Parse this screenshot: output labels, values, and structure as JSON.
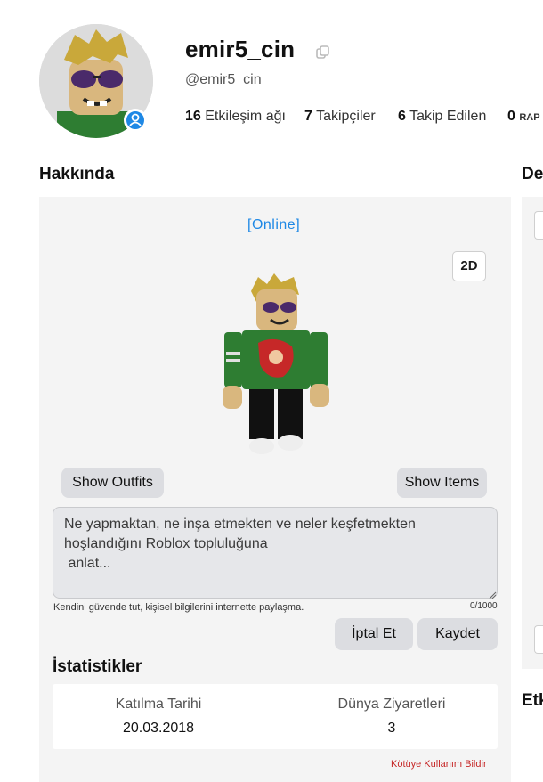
{
  "profile": {
    "display_name": "emir5_cin",
    "handle": "@emir5_cin",
    "stats": [
      {
        "count": "16",
        "label": "Etkileşim ağı"
      },
      {
        "count": "7",
        "label": "Takipçiler"
      },
      {
        "count": "6",
        "label": "Takip Edilen"
      },
      {
        "count": "0",
        "label": "RAP"
      }
    ]
  },
  "about": {
    "title": "Hakkında",
    "online_status": "[Online]",
    "view_toggle_label": "2D",
    "show_outfits_label": "Show Outfits",
    "show_items_label": "Show Items",
    "bio_placeholder": "Ne yapmaktan, ne inşa etmekten ve neler keşfetmekten hoşlandığını Roblox topluluğuna\n anlat...",
    "safety_note": "Kendini güvende tut, kişisel bilgilerini internette paylaşma.",
    "char_count": "0/1000",
    "cancel_label": "İptal Et",
    "save_label": "Kaydet",
    "statistics": {
      "title": "İstatistikler",
      "join_date_label": "Katılma Tarihi",
      "join_date_value": "20.03.2018",
      "visits_label": "Dünya Ziyaretleri",
      "visits_value": "3"
    },
    "report_label": "Kötüye Kullanım Bildir"
  },
  "right_column": {
    "title_fragment": "De",
    "bottom_title_fragment": "Etk"
  },
  "colors": {
    "accent_blue": "#1e88e5",
    "report_red": "#c62828",
    "panel_bg": "#f4f4f4"
  },
  "icons": [
    "copy-icon",
    "user-badge-icon"
  ]
}
